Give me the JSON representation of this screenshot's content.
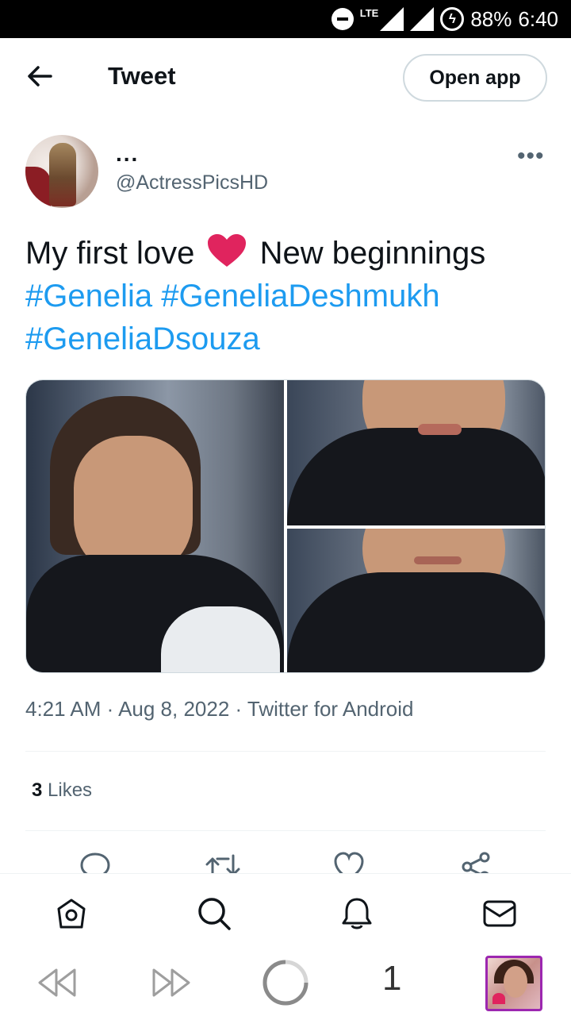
{
  "status_bar": {
    "network": "LTE",
    "battery": "88%",
    "time": "6:40"
  },
  "header": {
    "title": "Tweet",
    "open_app_label": "Open app"
  },
  "tweet": {
    "author_name": "...",
    "author_handle": "@ActressPicsHD",
    "text_before_emoji": "My first love",
    "text_after_emoji": "New beginnings",
    "hashtags": [
      "#Genelia",
      "#GeneliaDeshmukh",
      "#GeneliaDsouza"
    ],
    "timestamp": "4:21 AM · Aug 8, 2022 · Twitter for Android",
    "likes_count": "3",
    "likes_label": "Likes"
  },
  "browser": {
    "tab_count": "1"
  },
  "icons": {
    "back": "arrow-left-icon",
    "more": "more-horizontal-icon",
    "heart_emoji": "red-heart-emoji",
    "reply": "reply-icon",
    "retweet": "retweet-icon",
    "like": "like-icon",
    "share": "share-icon",
    "home": "home-icon",
    "search": "search-icon",
    "notifications": "bell-icon",
    "messages": "mail-icon"
  },
  "colors": {
    "hashtag": "#1d9bf0",
    "text_primary": "#0f1419",
    "text_secondary": "#536471",
    "heart": "#e0245e",
    "tab_border": "#9c27b0"
  }
}
